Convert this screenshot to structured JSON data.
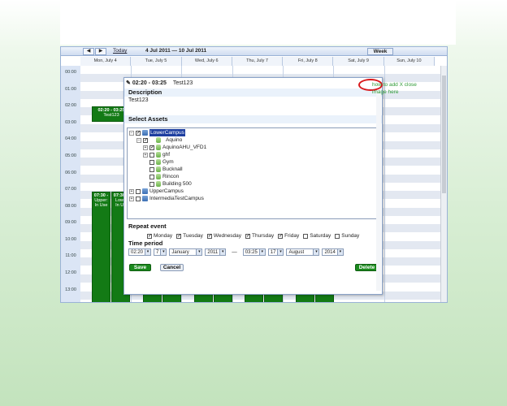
{
  "toolbar": {
    "prev_icon": "◀",
    "next_icon": "▶",
    "today_label": "Today",
    "date_range": "4 Jul 2011 — 10 Jul 2011",
    "view_label": "Week"
  },
  "days": [
    "Mon, July 4",
    "Tue, July 5",
    "Wed, July 6",
    "Thu, July 7",
    "Fri, July 8",
    "Sat, July 9",
    "Sun, July 10"
  ],
  "times": [
    "00:00",
    "01:00",
    "02:00",
    "03:00",
    "04:00",
    "05:00",
    "06:00",
    "07:00",
    "08:00",
    "09:00",
    "10:00",
    "11:00",
    "12:00",
    "13:00"
  ],
  "events": {
    "short": {
      "time": "02:20 - 03:25",
      "title": "Test123"
    },
    "mon_time": "07:30 -",
    "mon_line1": "Upper:",
    "mon_line2": "In Use",
    "tue_time": "07:30 -",
    "tue_line1": "Lowe",
    "tue_line2": "In Us"
  },
  "dialog": {
    "title_time": "02:20 - 03:25",
    "title_name": "Test123",
    "description_header": "Description",
    "description_value": "Test123",
    "assets_header": "Select Assets",
    "tree": {
      "lower_campus": "LowerCampus",
      "aquino": "Aquino",
      "aquino_ahu": "AquinoAHU_VFD1",
      "ghf": "ghf",
      "gym": "Gym",
      "bucknall": "Bucknall",
      "rincon": "Rincon",
      "building500": "Building 500",
      "upper_campus": "UpperCampus",
      "intermedia": "IntermediaTestCampus"
    },
    "repeat_header": "Repeat event",
    "repeat_days": [
      {
        "label": "Monday",
        "checked": true
      },
      {
        "label": "Tuesday",
        "checked": true
      },
      {
        "label": "Wednesday",
        "checked": true
      },
      {
        "label": "Thursday",
        "checked": true
      },
      {
        "label": "Friday",
        "checked": true
      },
      {
        "label": "Saturday",
        "checked": false
      },
      {
        "label": "Sunday",
        "checked": false
      }
    ],
    "time_header": "Time period",
    "start": {
      "time": "02:20",
      "day": "7",
      "month": "January",
      "year": "2011"
    },
    "separator": "—",
    "end": {
      "time": "03:25",
      "day": "17",
      "month": "August",
      "year": "2014"
    },
    "save_label": "Save",
    "cancel_label": "Cancel",
    "delete_label": "Delete"
  },
  "annotation": {
    "line1": "how to add X close",
    "line2": "image here"
  },
  "colors": {
    "event_green": "#137a15",
    "annotation_red": "#d9191c",
    "annotation_text": "#2f9a36",
    "selection_blue": "#1e3fa0"
  }
}
